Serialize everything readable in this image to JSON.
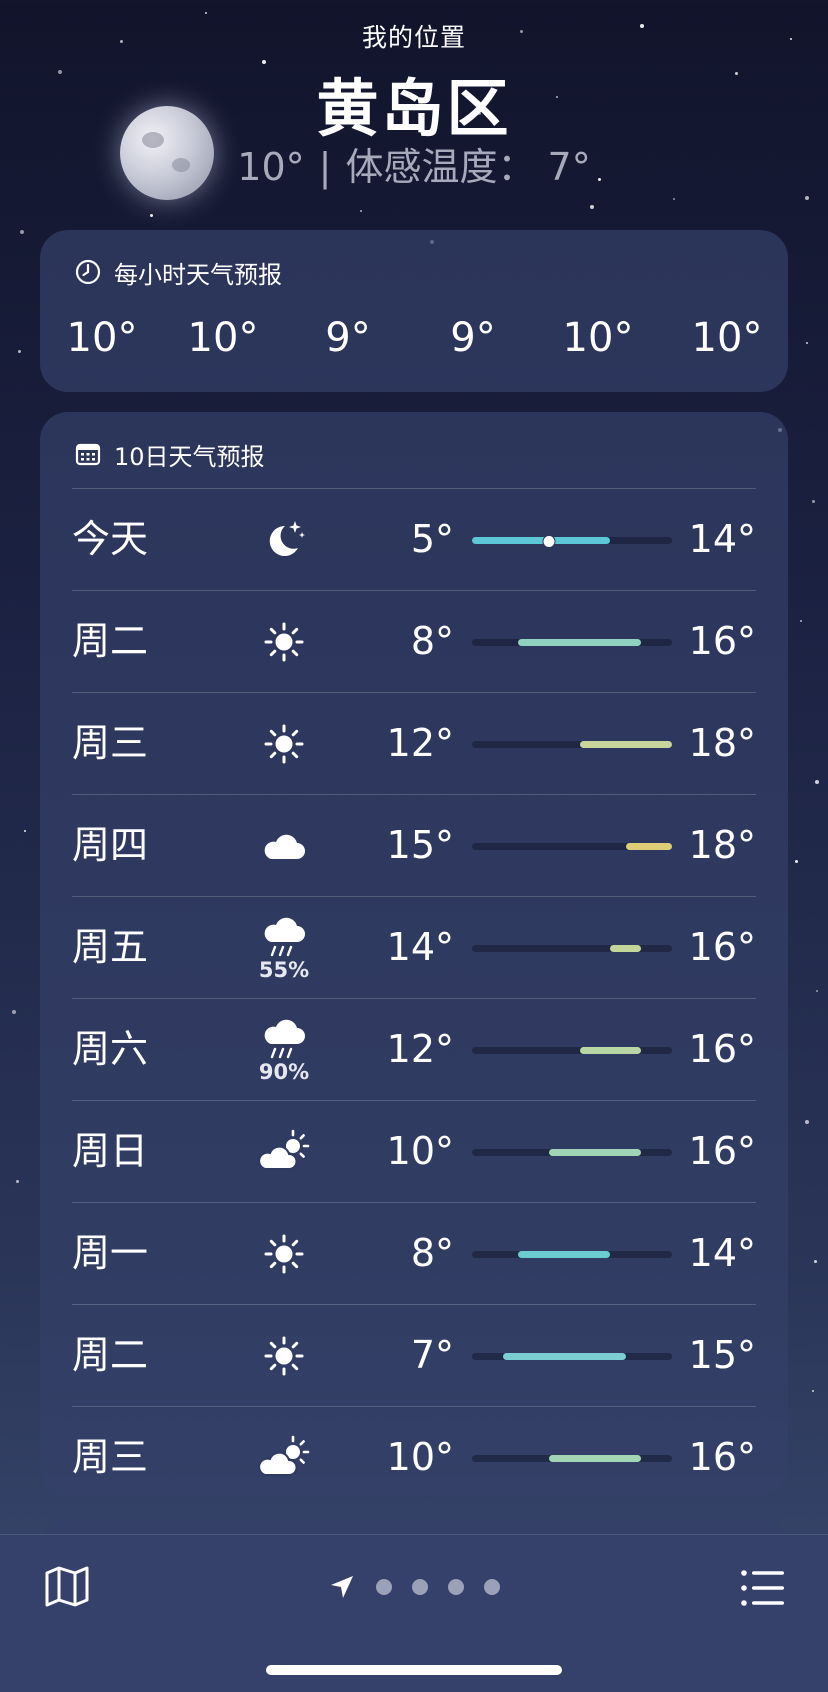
{
  "header": {
    "location_label": "我的位置",
    "city": "黄岛区",
    "current_temp": "10°",
    "separator": "|",
    "feels_like": "体感温度： 7°"
  },
  "hourly": {
    "title": "每小时天气预报",
    "icon": "clock-icon",
    "temps": [
      "10°",
      "10°",
      "9°",
      "9°",
      "10°",
      "10°"
    ]
  },
  "daily": {
    "title": "10日天气预报",
    "icon": "calendar-icon",
    "range_min": 5,
    "range_max": 18,
    "current_temp": 10,
    "days": [
      {
        "name": "今天",
        "icon": "moon-stars-icon",
        "precip": "",
        "low": "5°",
        "high": "14°",
        "low_val": 5,
        "high_val": 14,
        "color": "#5cc8d6"
      },
      {
        "name": "周二",
        "icon": "sun-icon",
        "precip": "",
        "low": "8°",
        "high": "16°",
        "low_val": 8,
        "high_val": 16,
        "color": "#8fd2c0"
      },
      {
        "name": "周三",
        "icon": "sun-icon",
        "precip": "",
        "low": "12°",
        "high": "18°",
        "low_val": 12,
        "high_val": 18,
        "color": "#c7d59a"
      },
      {
        "name": "周四",
        "icon": "cloud-icon",
        "precip": "",
        "low": "15°",
        "high": "18°",
        "low_val": 15,
        "high_val": 18,
        "color": "#e0cd78"
      },
      {
        "name": "周五",
        "icon": "cloud-rain-icon",
        "precip": "55%",
        "low": "14°",
        "high": "16°",
        "low_val": 14,
        "high_val": 16,
        "color": "#c3d69a"
      },
      {
        "name": "周六",
        "icon": "cloud-rain-icon",
        "precip": "90%",
        "low": "12°",
        "high": "16°",
        "low_val": 12,
        "high_val": 16,
        "color": "#b9d7a4"
      },
      {
        "name": "周日",
        "icon": "cloud-sun-icon",
        "precip": "",
        "low": "10°",
        "high": "16°",
        "low_val": 10,
        "high_val": 16,
        "color": "#9fd4b4"
      },
      {
        "name": "周一",
        "icon": "sun-icon",
        "precip": "",
        "low": "8°",
        "high": "14°",
        "low_val": 8,
        "high_val": 14,
        "color": "#6ccdd0"
      },
      {
        "name": "周二",
        "icon": "sun-icon",
        "precip": "",
        "low": "7°",
        "high": "15°",
        "low_val": 7,
        "high_val": 15,
        "color": "#7bcfd2"
      },
      {
        "name": "周三",
        "icon": "cloud-sun-icon",
        "precip": "",
        "low": "10°",
        "high": "16°",
        "low_val": 10,
        "high_val": 16,
        "color": "#a2d5b4"
      }
    ]
  },
  "bottom_bar": {
    "map_icon": "map-icon",
    "location_icon": "location-arrow-icon",
    "page_count": 4,
    "list_icon": "list-icon"
  }
}
